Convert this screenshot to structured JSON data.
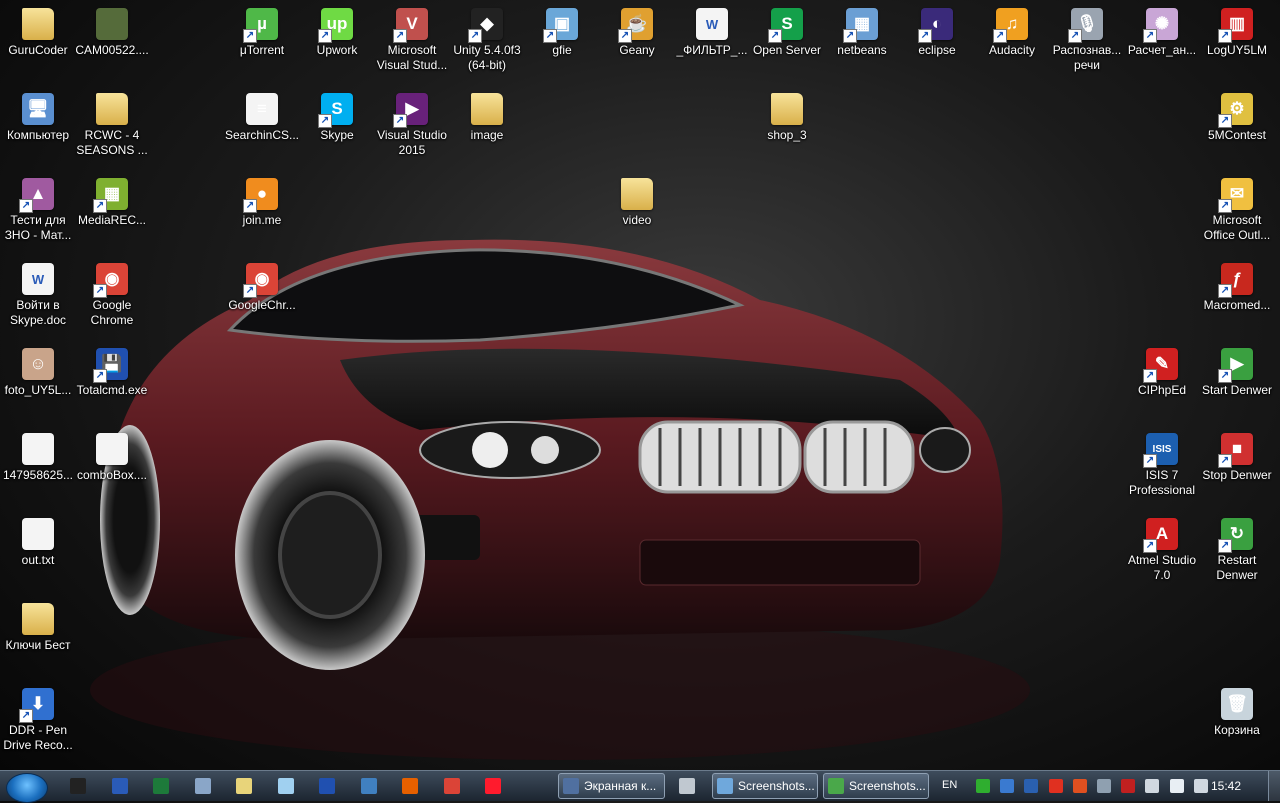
{
  "desktop": {
    "icons": [
      {
        "label": "GuruCoder",
        "icon": "folder-user-icon",
        "color": "#d9b04a",
        "glyph": ""
      },
      {
        "label": "CAM00522....",
        "icon": "photo-icon",
        "color": "#556b3a",
        "glyph": ""
      },
      {
        "label": "μTorrent",
        "icon": "utorrent-icon",
        "color": "#4fb848",
        "glyph": "µ"
      },
      {
        "label": "Upwork",
        "icon": "upwork-icon",
        "color": "#6fda44",
        "glyph": "up"
      },
      {
        "label": "Microsoft\nVisual Stud...",
        "icon": "visual-studio-installer-icon",
        "color": "#c0504d",
        "glyph": "V"
      },
      {
        "label": "Unity 5.4.0f3\n(64-bit)",
        "icon": "unity-icon",
        "color": "#222222",
        "glyph": "◆"
      },
      {
        "label": "gfie",
        "icon": "gfie-icon",
        "color": "#6aa7d8",
        "glyph": "▣"
      },
      {
        "label": "Geany",
        "icon": "geany-icon",
        "color": "#e0a030",
        "glyph": "☕"
      },
      {
        "label": "_ФИЛЬТР_...",
        "icon": "word-doc-icon",
        "color": "#f4f4f4",
        "glyph": "W"
      },
      {
        "label": "Open Server",
        "icon": "open-server-icon",
        "color": "#14a04a",
        "glyph": "S"
      },
      {
        "label": "netbeans",
        "icon": "netbeans-icon",
        "color": "#6b9fd4",
        "glyph": "▦"
      },
      {
        "label": "eclipse",
        "icon": "eclipse-icon",
        "color": "#3a2a7a",
        "glyph": "◐"
      },
      {
        "label": "Audacity",
        "icon": "audacity-icon",
        "color": "#f0a020",
        "glyph": "♫"
      },
      {
        "label": "Распознав...\nречи",
        "icon": "speech-recognition-icon",
        "color": "#9aa4b0",
        "glyph": "🎙"
      },
      {
        "label": "Расчет_ан...",
        "icon": "calc-antenna-icon",
        "color": "#c9a6d6",
        "glyph": "✺"
      },
      {
        "label": "LogUY5LM",
        "icon": "log-uy5lm-icon",
        "color": "#d02020",
        "glyph": "▥"
      },
      {
        "label": "Компьютер",
        "icon": "computer-icon",
        "color": "#5a8fd0",
        "glyph": "🖥"
      },
      {
        "label": "RCWC - 4\nSEASONS ...",
        "icon": "folder-icon",
        "color": "#d9b04a",
        "glyph": ""
      },
      {
        "label": "SearchinCS...",
        "icon": "file-icon",
        "color": "#f4f4f4",
        "glyph": "≡"
      },
      {
        "label": "Skype",
        "icon": "skype-icon",
        "color": "#00aff0",
        "glyph": "S"
      },
      {
        "label": "Visual Studio\n2015",
        "icon": "visual-studio-icon",
        "color": "#68217a",
        "glyph": "▶"
      },
      {
        "label": "image",
        "icon": "folder-icon",
        "color": "#d9b04a",
        "glyph": ""
      },
      {
        "label": "shop_3",
        "icon": "folder-icon",
        "color": "#d9b04a",
        "glyph": ""
      },
      {
        "label": "5MContest",
        "icon": "contest-icon",
        "color": "#e0c040",
        "glyph": "⚙"
      },
      {
        "label": "Тести для\nЗНО - Мат...",
        "icon": "tests-icon",
        "color": "#a05aa0",
        "glyph": "▲"
      },
      {
        "label": "MediaREC...",
        "icon": "mediarec-icon",
        "color": "#7fb030",
        "glyph": "▦"
      },
      {
        "label": "join.me",
        "icon": "joinme-icon",
        "color": "#f08c1e",
        "glyph": "●"
      },
      {
        "label": "video",
        "icon": "folder-icon",
        "color": "#d9b04a",
        "glyph": ""
      },
      {
        "label": "Microsoft\nOffice Outl...",
        "icon": "outlook-icon",
        "color": "#f0c040",
        "glyph": "✉"
      },
      {
        "label": "Войти в\nSkype.doc",
        "icon": "word-doc-icon",
        "color": "#f4f4f4",
        "glyph": "W"
      },
      {
        "label": "Google\nChrome",
        "icon": "chrome-icon",
        "color": "#db4437",
        "glyph": "◉"
      },
      {
        "label": "GoogleChr...",
        "icon": "chrome-icon",
        "color": "#db4437",
        "glyph": "◉"
      },
      {
        "label": "Macromed...",
        "icon": "flash-icon",
        "color": "#c8281e",
        "glyph": "ƒ"
      },
      {
        "label": "foto_UY5L...",
        "icon": "photo-icon",
        "color": "#c9a48a",
        "glyph": "☺"
      },
      {
        "label": "Totalcmd.exe",
        "icon": "total-commander-icon",
        "color": "#2050b0",
        "glyph": "💾"
      },
      {
        "label": "CIPhpEd",
        "icon": "phped-icon",
        "color": "#d02020",
        "glyph": "✎"
      },
      {
        "label": "Start Denwer",
        "icon": "denwer-start-icon",
        "color": "#3aa040",
        "glyph": "▶"
      },
      {
        "label": "147958625...",
        "icon": "text-file-icon",
        "color": "#f4f4f4",
        "glyph": ""
      },
      {
        "label": "comboBox....",
        "icon": "text-file-icon",
        "color": "#f4f4f4",
        "glyph": ""
      },
      {
        "label": "ISIS 7\nProfessional",
        "icon": "isis-icon",
        "color": "#1c5fb0",
        "glyph": "ISIS"
      },
      {
        "label": "Stop Denwer",
        "icon": "denwer-stop-icon",
        "color": "#d03030",
        "glyph": "■"
      },
      {
        "label": "out.txt",
        "icon": "text-file-icon",
        "color": "#f4f4f4",
        "glyph": ""
      },
      {
        "label": "Atmel Studio\n7.0",
        "icon": "atmel-studio-icon",
        "color": "#d02020",
        "glyph": "A"
      },
      {
        "label": "Restart\nDenwer",
        "icon": "denwer-restart-icon",
        "color": "#3aa040",
        "glyph": "↻"
      },
      {
        "label": "Ключи Бест",
        "icon": "folder-icon",
        "color": "#d9b04a",
        "glyph": ""
      },
      {
        "label": "DDR - Pen\nDrive Reco...",
        "icon": "ddr-recovery-icon",
        "color": "#3070d0",
        "glyph": "⬇"
      },
      {
        "label": "Корзина",
        "icon": "recycle-bin-icon",
        "color": "#c8d4dc",
        "glyph": "🗑"
      }
    ]
  },
  "taskbar": {
    "pinned": [
      {
        "icon": "cmd-icon",
        "color": "#222222"
      },
      {
        "icon": "word-icon",
        "color": "#2a5bb8"
      },
      {
        "icon": "excel-icon",
        "color": "#1d7a3a"
      },
      {
        "icon": "calculator-icon",
        "color": "#8aa6c8"
      },
      {
        "icon": "notepad-icon",
        "color": "#e8d47a"
      },
      {
        "icon": "notepad-plus-icon",
        "color": "#a0d0f0"
      },
      {
        "icon": "total-commander-icon",
        "color": "#2050b0"
      },
      {
        "icon": "network-icon",
        "color": "#4080c0"
      },
      {
        "icon": "firefox-icon",
        "color": "#e66000"
      },
      {
        "icon": "chrome-icon",
        "color": "#db4437"
      },
      {
        "icon": "opera-icon",
        "color": "#ff1b2d"
      }
    ],
    "windows": [
      {
        "label": "Экранная к...",
        "icon": "keyboard-icon",
        "color": "#5070a0"
      },
      {
        "label": "",
        "icon": "taskbar-app-icon",
        "color": "#c0c8d0"
      },
      {
        "label": "Screenshots...",
        "icon": "screenshots-icon",
        "color": "#6fa8dc"
      },
      {
        "label": "Screenshots...",
        "icon": "screenshots-app-icon",
        "color": "#4aa84a"
      }
    ],
    "language": "EN",
    "tray": [
      {
        "icon": "flag-tray-icon",
        "color": "#2fae2f"
      },
      {
        "icon": "monitor-tray-icon",
        "color": "#3a7ad0"
      },
      {
        "icon": "display-tray-icon",
        "color": "#2a60b0"
      },
      {
        "icon": "opera-tray-icon",
        "color": "#e03020"
      },
      {
        "icon": "speaker-off-tray-icon",
        "color": "#e05020"
      },
      {
        "icon": "usb-tray-icon",
        "color": "#8fa0b0"
      },
      {
        "icon": "network-x-tray-icon",
        "color": "#c02020"
      },
      {
        "icon": "action-center-tray-icon",
        "color": "#d0d8e0"
      },
      {
        "icon": "volume-tray-icon",
        "color": "#e8eef4"
      },
      {
        "icon": "power-tray-icon",
        "color": "#d0d8e0"
      }
    ],
    "clock": "15:42"
  }
}
